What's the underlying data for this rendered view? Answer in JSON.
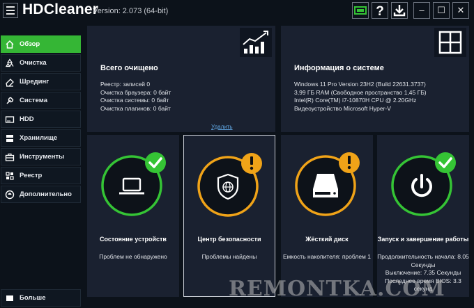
{
  "app": {
    "title": "HDCleaner",
    "version": "Version: 2.073 (64-bit)"
  },
  "titlebar": {
    "icons": [
      "monitor-icon",
      "help-icon",
      "download-icon"
    ],
    "window_buttons": [
      "minimize-icon",
      "maximize-icon",
      "close-icon"
    ]
  },
  "sidebar": {
    "items": [
      {
        "label": "Обзор",
        "icon": "home-icon",
        "active": true
      },
      {
        "label": "Очистка",
        "icon": "recycle-icon"
      },
      {
        "label": "Шрединг",
        "icon": "eraser-icon"
      },
      {
        "label": "Система",
        "icon": "wrench-icon"
      },
      {
        "label": "HDD",
        "icon": "drive-icon"
      },
      {
        "label": "Хранилище",
        "icon": "storage-icon"
      },
      {
        "label": "Инструменты",
        "icon": "toolbox-icon"
      },
      {
        "label": "Реестр",
        "icon": "registry-icon"
      },
      {
        "label": "Дополнительно",
        "icon": "extra-icon"
      }
    ],
    "more_label": "Больше"
  },
  "cleaned": {
    "title": "Всего очищено",
    "lines": [
      "Реестр: записей 0",
      "Очистка браузера: 0 байт",
      "Очистка системы: 0 байт",
      "Очистка плагинов: 0 байт"
    ],
    "delete_link": "Удалить"
  },
  "sysinfo": {
    "title": "Информация о системе",
    "lines": [
      "Windows 11 Pro Version 23H2 (Build 22631.3737)",
      "3,99 ГБ RAM (Свободное пространство 1,45 ГБ)",
      "Intel(R) Core(TM) i7-10870H CPU @ 2.20GHz",
      "Видеоустройство Microsoft Hyper-V"
    ]
  },
  "cards": [
    {
      "title": "Состояние устройств",
      "status": [
        "Проблем не обнаружено"
      ],
      "ring_color": "#35c435",
      "badge": "check",
      "icon": "laptop-icon"
    },
    {
      "title": "Центр безопасности",
      "status": [
        "Проблемы найдены"
      ],
      "ring_color": "#f0a318",
      "badge": "warning",
      "icon": "shield-globe-icon"
    },
    {
      "title": "Жёсткий диск",
      "status": [
        "Емкость накопителя: проблем 1"
      ],
      "ring_color": "#f0a318",
      "badge": "warning",
      "icon": "hard-drive-icon"
    },
    {
      "title": "Запуск и завершение работы",
      "status": [
        "Продолжительность начала: 8.05",
        "Секунды",
        "Выключение: 7.35 Секунды",
        "Последнее время BIOS: 3.3",
        "секунд"
      ],
      "ring_color": "#35c435",
      "badge": "check",
      "icon": "power-icon"
    }
  ],
  "colors": {
    "accent_green": "#35b635",
    "warning_orange": "#f0a318",
    "panel_bg": "#1a2130",
    "app_bg": "#0c121a"
  },
  "watermark": "REMONTKA.COM"
}
